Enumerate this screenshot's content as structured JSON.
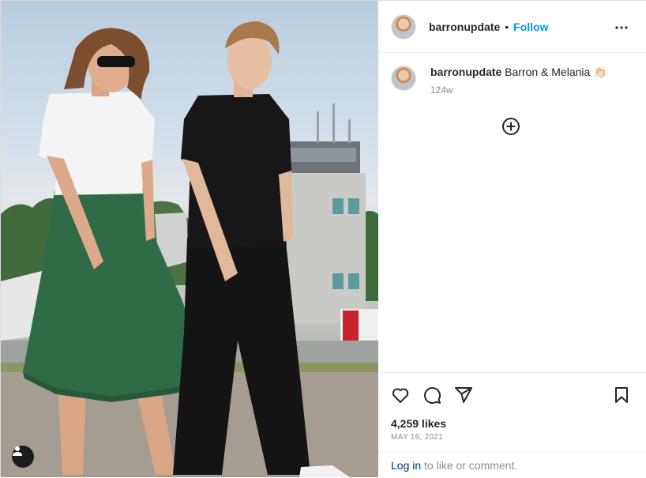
{
  "post": {
    "username": "barronupdate",
    "separator": "•",
    "follow_label": "Follow",
    "caption_text": "Barron & Melania 👏🏻",
    "caption_time": "124w",
    "likes": "4,259 likes",
    "date": "MAY 16, 2021",
    "login_link": "Log in",
    "login_suffix": " to like or comment."
  },
  "icons": {
    "more": "more-options-icon",
    "load_more": "plus-circle-icon",
    "like": "heart-icon",
    "comment": "comment-bubble-icon",
    "share": "paper-plane-icon",
    "save": "bookmark-icon",
    "user_tag": "user-tag-icon"
  },
  "colors": {
    "follow": "#0095f6",
    "text": "#262626",
    "muted": "#8e8e8e",
    "link": "#00376b",
    "skirt": "#2e6b46",
    "shirt_black": "#141414"
  }
}
